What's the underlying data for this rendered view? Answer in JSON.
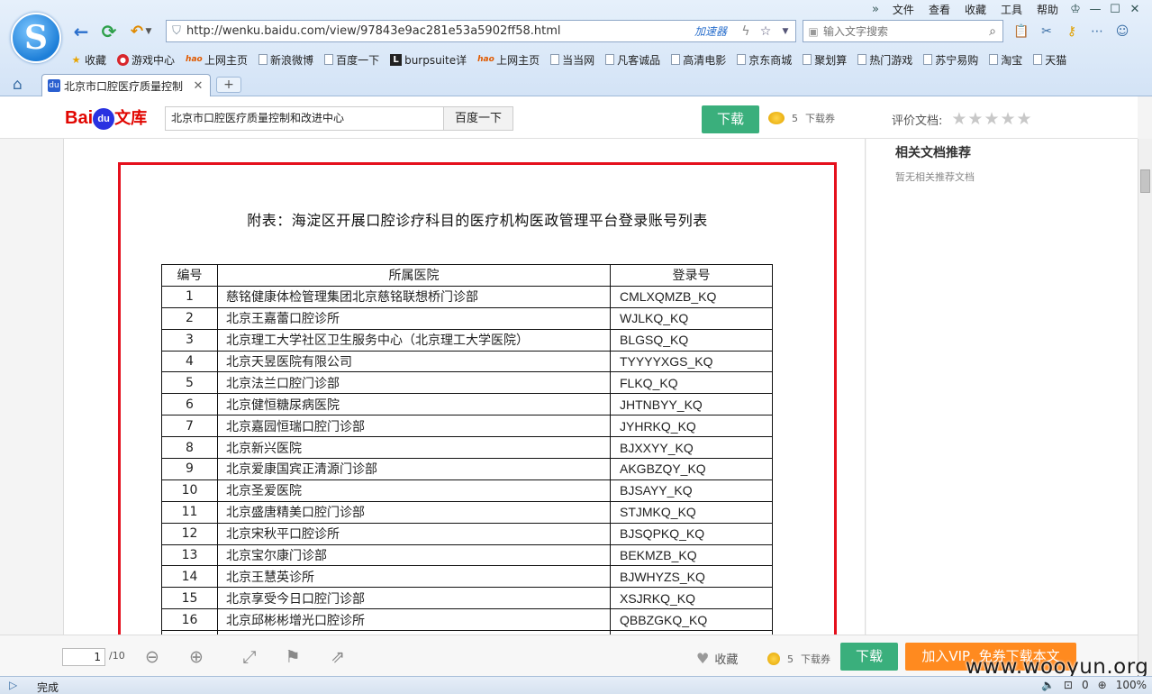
{
  "browser": {
    "menu": [
      "文件",
      "查看",
      "收藏",
      "工具",
      "帮助"
    ],
    "address_url": "http://wenku.baidu.com/view/97843e9ac281e53a5902ff58.html",
    "accelerator_label": "加速器",
    "search_placeholder": "输入文字搜索",
    "bookmarks": [
      {
        "label": "收藏",
        "icon": "star-icon"
      },
      {
        "label": "游戏中心",
        "icon": "game-icon"
      },
      {
        "label": "上网主页",
        "icon": "hao-icon"
      },
      {
        "label": "新浪微博",
        "icon": "page-icon"
      },
      {
        "label": "百度一下",
        "icon": "page-icon"
      },
      {
        "label": "burpsuite详",
        "icon": "l-icon"
      },
      {
        "label": "上网主页",
        "icon": "hao-icon"
      },
      {
        "label": "当当网",
        "icon": "page-icon"
      },
      {
        "label": "凡客诚品",
        "icon": "page-icon"
      },
      {
        "label": "高清电影",
        "icon": "page-icon"
      },
      {
        "label": "京东商城",
        "icon": "page-icon"
      },
      {
        "label": "聚划算",
        "icon": "page-icon"
      },
      {
        "label": "热门游戏",
        "icon": "page-icon"
      },
      {
        "label": "苏宁易购",
        "icon": "page-icon"
      },
      {
        "label": "淘宝",
        "icon": "page-icon"
      },
      {
        "label": "天猫",
        "icon": "page-icon"
      }
    ],
    "tab_title": "北京市口腔医疗质量控制",
    "status_text": "完成",
    "status_count": "0",
    "zoom": "100%"
  },
  "header": {
    "logo_text": "Bai",
    "logo_du": "du",
    "logo_wenku": "文库",
    "search_value": "北京市口腔医疗质量控制和改进中心",
    "search_button": "百度一下",
    "download_button": "下载",
    "coupon_count": "5",
    "coupon_label": "下载券",
    "rate_label": "评价文档:"
  },
  "document": {
    "title": "附表：海淀区开展口腔诊疗科目的医疗机构医政管理平台登录账号列表",
    "columns": [
      "编号",
      "所属医院",
      "登录号"
    ],
    "rows": [
      [
        "1",
        "慈铭健康体检管理集团北京慈铭联想桥门诊部",
        "CMLXQMZB_KQ"
      ],
      [
        "2",
        "北京王嘉蕾口腔诊所",
        "WJLKQ_KQ"
      ],
      [
        "3",
        "北京理工大学社区卫生服务中心（北京理工大学医院）",
        "BLGSQ_KQ"
      ],
      [
        "4",
        "北京天昱医院有限公司",
        "TYYYYXGS_KQ"
      ],
      [
        "5",
        "北京法兰口腔门诊部",
        "FLKQ_KQ"
      ],
      [
        "6",
        "北京健恒糖尿病医院",
        "JHTNBYY_KQ"
      ],
      [
        "7",
        "北京嘉园恒瑞口腔门诊部",
        "JYHRKQ_KQ"
      ],
      [
        "8",
        "北京新兴医院",
        "BJXXYY_KQ"
      ],
      [
        "9",
        "北京爱康国宾正清源门诊部",
        "AKGBZQY_KQ"
      ],
      [
        "10",
        "北京圣爱医院",
        "BJSAYY_KQ"
      ],
      [
        "11",
        "北京盛唐精美口腔门诊部",
        "STJMKQ_KQ"
      ],
      [
        "12",
        "北京宋秋平口腔诊所",
        "BJSQPKQ_KQ"
      ],
      [
        "13",
        "北京宝尔康门诊部",
        "BEKMZB_KQ"
      ],
      [
        "14",
        "北京王慧英诊所",
        "BJWHYZS_KQ"
      ],
      [
        "15",
        "北京享受今日口腔门诊部",
        "XSJRKQ_KQ"
      ],
      [
        "16",
        "北京邱彬彬增光口腔诊所",
        "QBBZGKQ_KQ"
      ]
    ]
  },
  "sidebar": {
    "title": "相关文档推荐",
    "empty_text": "暂无相关推荐文档"
  },
  "toolbar": {
    "page_current": "1",
    "page_total": "/10",
    "favorite_label": "收藏",
    "coupon_count": "5",
    "coupon_label": "下载券",
    "download_button": "下载",
    "vip_button": "加入VIP, 免券下载本文"
  },
  "watermark": "www.wooyun.org",
  "colors": {
    "accent_green": "#3aaf7c",
    "vip_orange": "#ff8a1f",
    "highlight_red": "#e5101d",
    "baidu_red": "#e10601"
  }
}
